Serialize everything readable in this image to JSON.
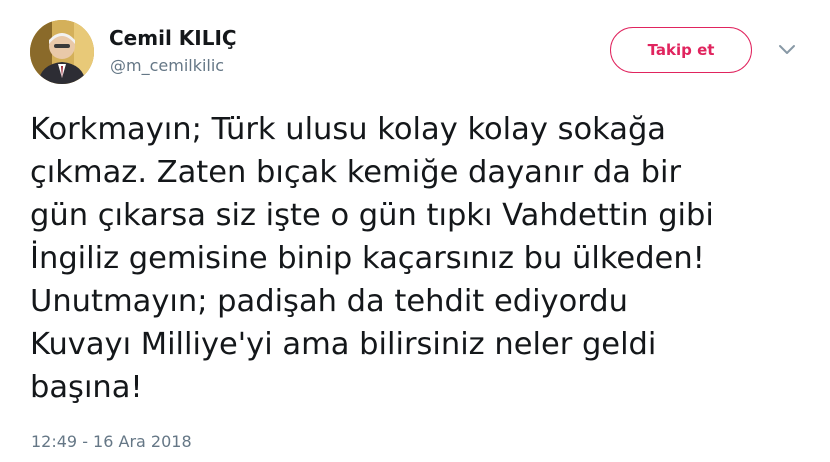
{
  "author": {
    "name": "Cemil KILIÇ",
    "handle": "@m_cemilkilic"
  },
  "actions": {
    "follow_label": "Takip et"
  },
  "icons": {
    "menu": "chevron-down-icon"
  },
  "colors": {
    "accent": "#e0245e",
    "muted": "#657786",
    "text": "#14171a"
  },
  "tweet": {
    "lines": [
      "Korkmayın; Türk ulusu kolay kolay sokağa",
      "çıkmaz. Zaten bıçak kemiğe dayanır da bir",
      "gün çıkarsa siz işte o gün tıpkı Vahdettin gibi",
      "İngiliz gemisine binip kaçarsınız bu ülkeden!",
      "Unutmayın; padişah da tehdit ediyordu",
      "Kuvayı Milliye'yi ama bilirsiniz neler geldi",
      "başına!"
    ],
    "timestamp": "12:49 - 16 Ara 2018"
  }
}
